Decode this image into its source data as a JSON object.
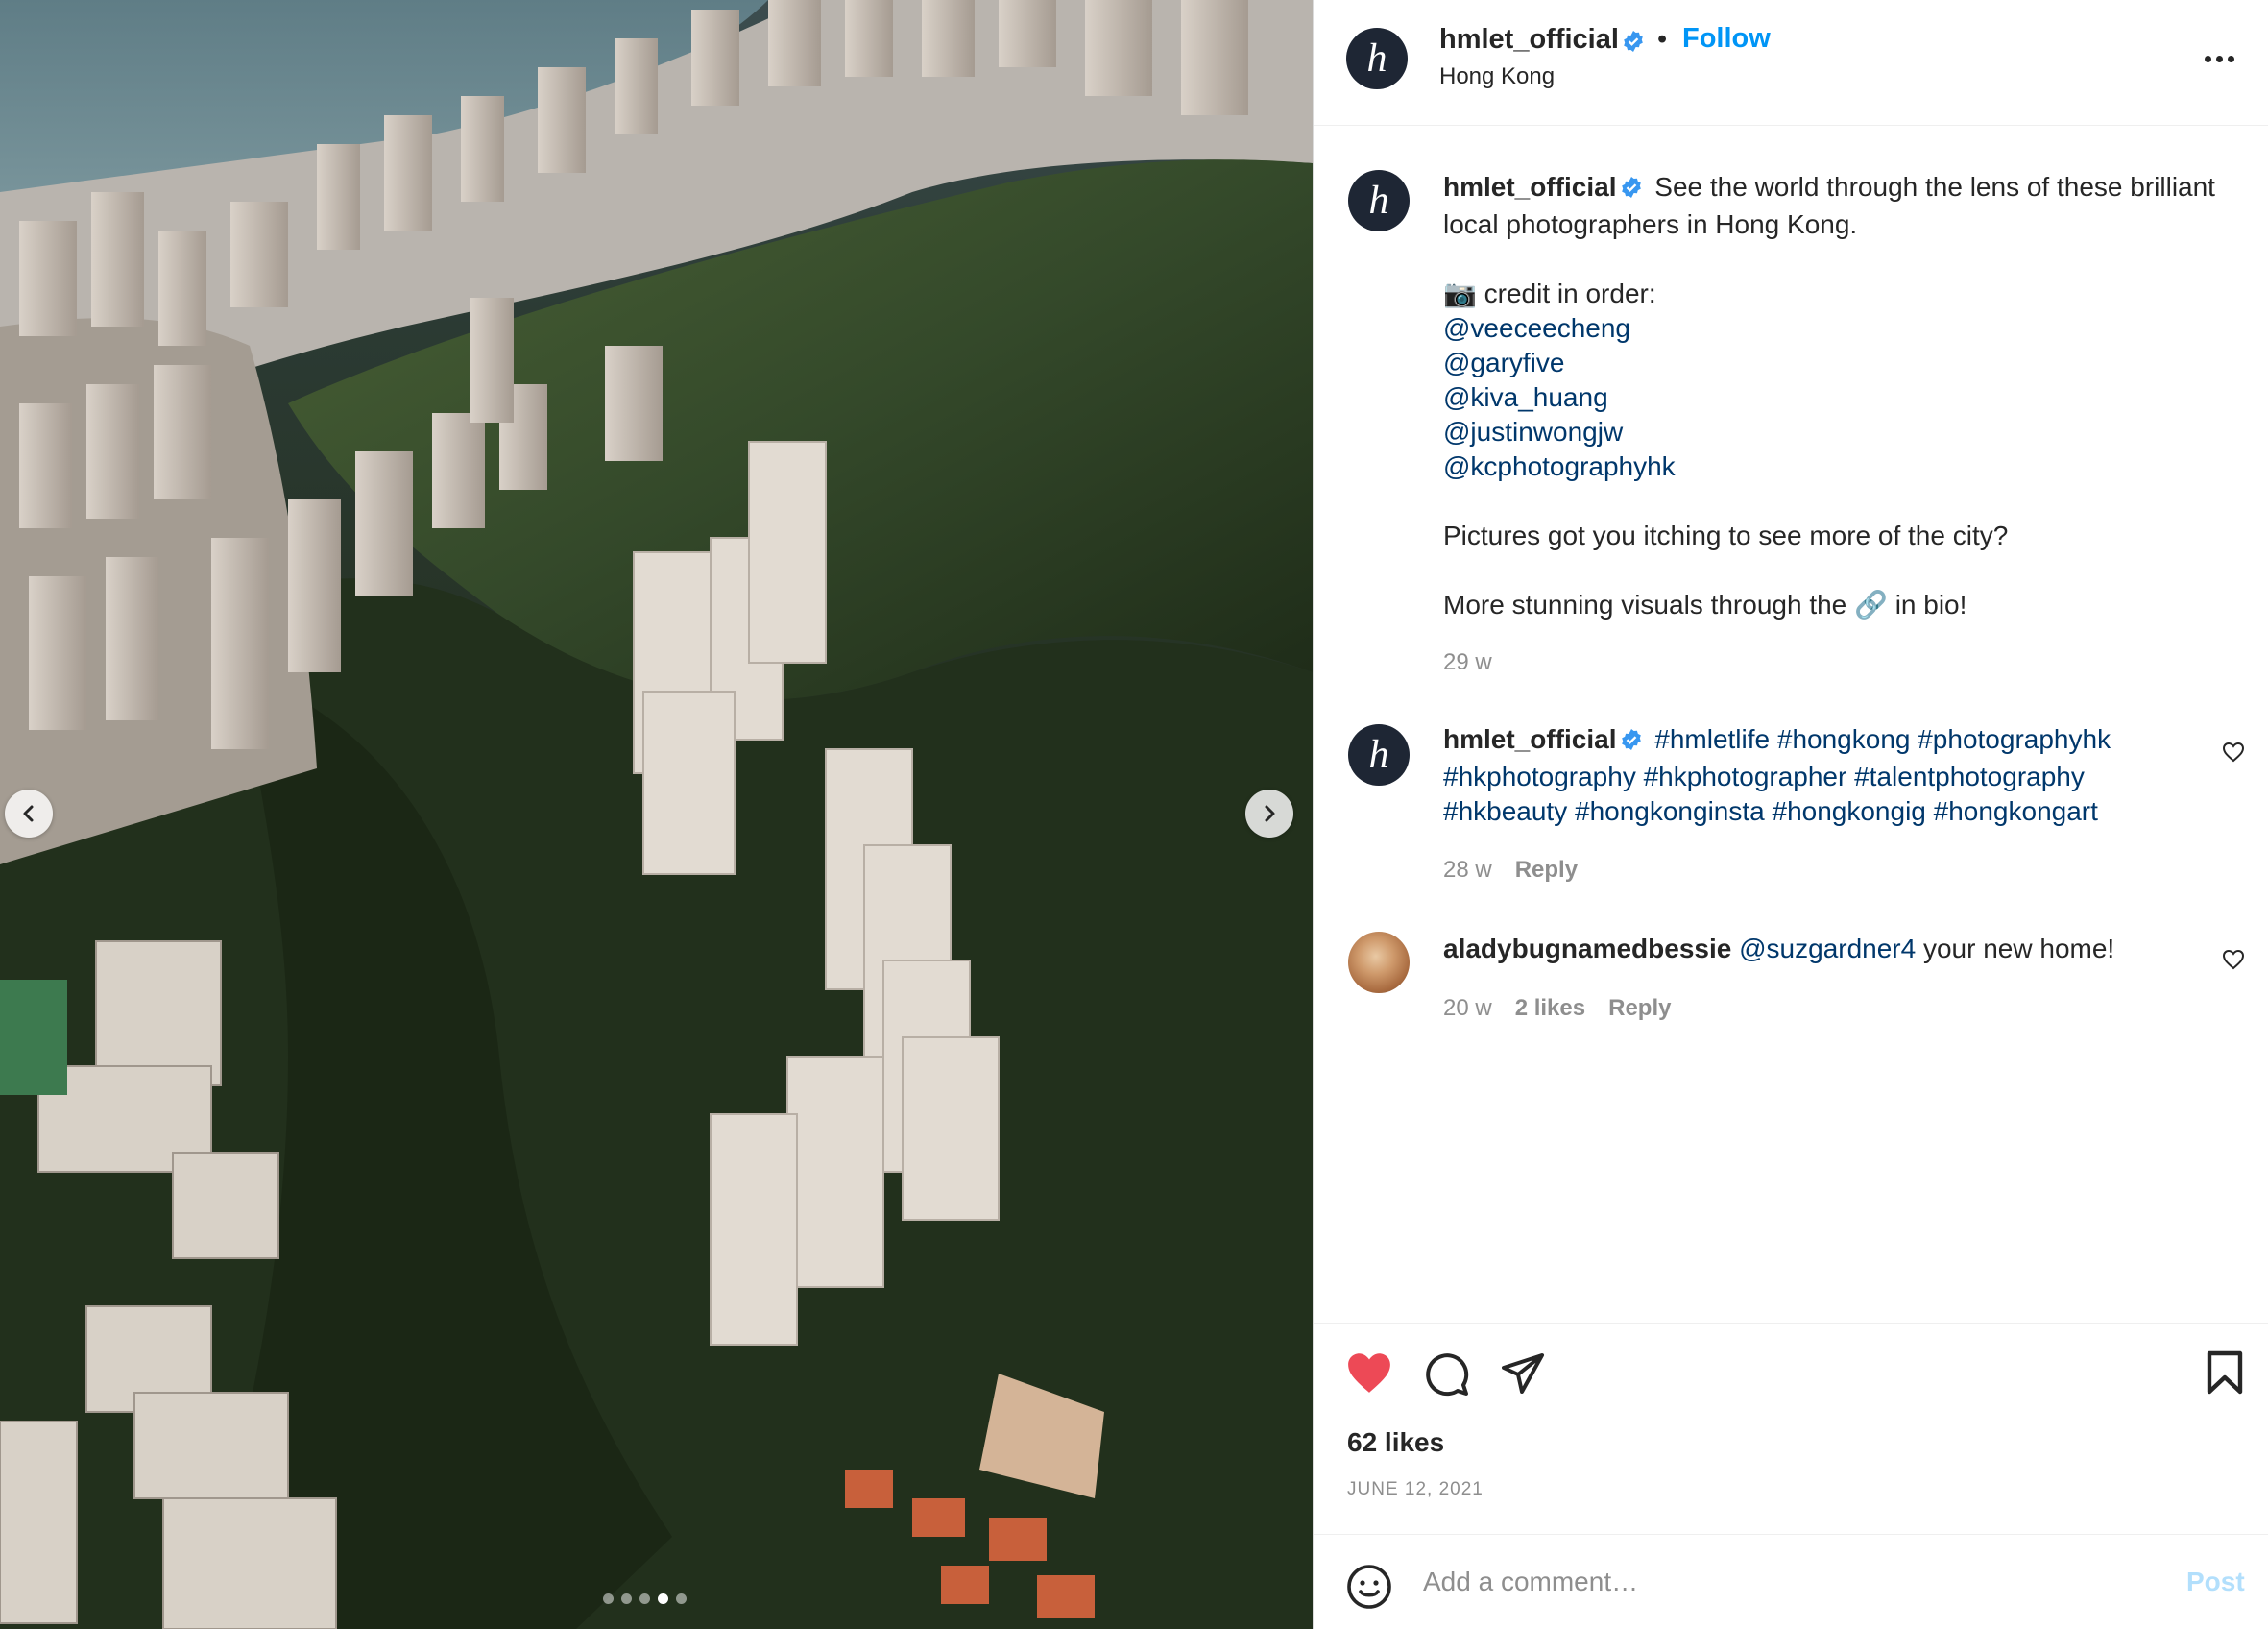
{
  "carousel": {
    "dots_total": 5,
    "active_index": 3
  },
  "header": {
    "username": "hmlet_official",
    "separator": "•",
    "follow_label": "Follow",
    "location": "Hong Kong",
    "avatar_letter": "h"
  },
  "caption": {
    "username": "hmlet_official",
    "text_intro": "See the world through the lens of these brilliant local photographers in Hong Kong.",
    "credit_icon": "📷",
    "credit_label": "credit in order:",
    "mentions": [
      "@veeceecheng",
      "@garyfive",
      "@kiva_huang",
      "@justinwongjw",
      "@kcphotographyhk"
    ],
    "line_question": "Pictures got you itching to see more of the city?",
    "line_bio_before": "More stunning visuals through the",
    "link_icon": "🔗",
    "line_bio_after": "in bio!",
    "time": "29 w"
  },
  "comments": [
    {
      "username": "hmlet_official",
      "hashtags": "#hmletlife #hongkong #photographyhk #hkphotography #hkphotographer #talentphotography #hkbeauty #hongkonginsta #hongkongig #hongkongart",
      "time": "28 w",
      "reply_label": "Reply"
    },
    {
      "username": "aladybugnamedbessie",
      "mention": "@suzgardner4",
      "text": "your new home!",
      "time": "20 w",
      "likes": "2 likes",
      "reply_label": "Reply"
    }
  ],
  "actions": {
    "likes": "62 likes",
    "date": "JUNE 12, 2021",
    "liked": true
  },
  "comment_bar": {
    "placeholder": "Add a comment…",
    "post_label": "Post"
  },
  "colors": {
    "link": "#0095f6",
    "mention": "#00376b",
    "verified": "#3897f0",
    "like_red": "#ed4956",
    "muted": "#8e8e8e",
    "post_disabled": "#b2dffc"
  }
}
